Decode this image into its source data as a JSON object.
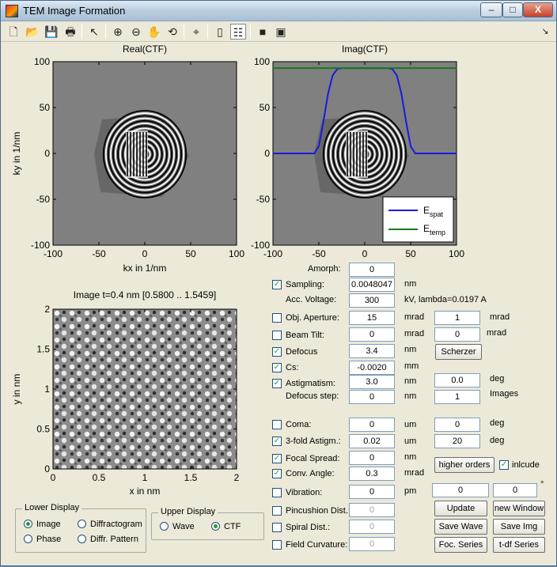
{
  "window": {
    "title": "TEM Image Formation",
    "controls": {
      "minimize": "–",
      "maximize": "□",
      "close": "X"
    }
  },
  "toolbar": {
    "icons": [
      "new-file-icon",
      "open-folder-icon",
      "save-icon",
      "print-icon",
      "pointer-icon",
      "zoom-in-icon",
      "zoom-out-icon",
      "pan-hand-icon",
      "rotate-icon",
      "data-cursor-icon",
      "colorbar-icon",
      "legend-icon",
      "hide-plot-tools-icon",
      "show-plot-tools-icon"
    ],
    "dock_arrow": "↘"
  },
  "plots": {
    "real_ctf": {
      "title": "Real(CTF)",
      "xlabel": "kx in 1/nm",
      "ylabel": "ky in 1/nm",
      "xticks": [
        "-100",
        "-50",
        "0",
        "50",
        "100"
      ],
      "yticks": [
        "100",
        "50",
        "0",
        "-50",
        "-100"
      ]
    },
    "imag_ctf": {
      "title": "Imag(CTF)",
      "xticks": [
        "-100",
        "-50",
        "0",
        "50",
        "100"
      ],
      "yticks": [
        "100",
        "50",
        "0",
        "-50",
        "-100"
      ],
      "legend": [
        {
          "name": "E",
          "sub": "spat",
          "color": "#1a1adf"
        },
        {
          "name": "E",
          "sub": "temp",
          "color": "#1a7a1a"
        }
      ]
    },
    "image": {
      "title": "Image t=0.4 nm [0.5800 .. 1.5459]",
      "xlabel": "x in nm",
      "ylabel": "y in nm",
      "xticks": [
        "0",
        "0.5",
        "1",
        "1.5",
        "2"
      ],
      "yticks": [
        "2",
        "1.5",
        "1",
        "0.5",
        "0"
      ]
    }
  },
  "chart_data": {
    "type": "line",
    "title": "Imag(CTF)",
    "xlim": [
      -100,
      100
    ],
    "ylim": [
      -100,
      100
    ],
    "series": [
      {
        "name": "E_spat",
        "color": "#1a1adf",
        "x": [
          -105,
          -55,
          -50,
          -45,
          -40,
          -35,
          -30,
          -25,
          -20,
          0,
          20,
          25,
          30,
          35,
          40,
          45,
          50,
          55,
          105
        ],
        "y": [
          0,
          0,
          8,
          35,
          65,
          85,
          92,
          93,
          93,
          93,
          93,
          93,
          92,
          85,
          65,
          35,
          8,
          0,
          0
        ]
      },
      {
        "name": "E_temp",
        "color": "#1a7a1a",
        "x": [
          -105,
          105
        ],
        "y": [
          93,
          93
        ]
      }
    ]
  },
  "params": {
    "amorph": {
      "label": "Amorph:",
      "value": "0"
    },
    "sampling": {
      "label": "Sampling:",
      "value": "0.0048047",
      "unit": "nm",
      "checked": true
    },
    "voltage": {
      "label": "Acc. Voltage:",
      "value": "300",
      "unit": "kV, lambda=0.0197 A"
    },
    "obj_aperture": {
      "label": "Obj. Aperture:",
      "value": "15",
      "unit": "mrad",
      "value2": "1",
      "unit2": "mrad",
      "checked": false
    },
    "beam_tilt": {
      "label": "Beam Tilt:",
      "value": "0",
      "unit": "mrad",
      "value2": "0",
      "unit2": "mrad",
      "checked": false
    },
    "defocus": {
      "label": "Defocus",
      "value": "3.4",
      "unit": "nm",
      "checked": true
    },
    "cs": {
      "label": "Cs:",
      "value": "-0.0020",
      "unit": "mm",
      "checked": true
    },
    "astig": {
      "label": "Astigmatism:",
      "value": "3.0",
      "unit": "nm",
      "value2": "0.0",
      "unit2": "deg",
      "checked": true
    },
    "defocus_step": {
      "label": "Defocus step:",
      "value": "0",
      "unit": "nm",
      "value2": "1",
      "unit2": "Images"
    },
    "coma": {
      "label": "Coma:",
      "value": "0",
      "unit": "um",
      "value2": "0",
      "unit2": "deg",
      "checked": false
    },
    "astig3": {
      "label": "3-fold Astigm.:",
      "value": "0.02",
      "unit": "um",
      "value2": "20",
      "unit2": "deg",
      "checked": true
    },
    "focal_spread": {
      "label": "Focal Spread:",
      "value": "0",
      "unit": "nm",
      "checked": true
    },
    "conv_angle": {
      "label": "Conv. Angle:",
      "value": "0.3",
      "unit": "mrad",
      "checked": true
    },
    "vibration": {
      "label": "Vibration:",
      "value": "0",
      "unit": "pm",
      "value2": "0",
      "unit2": "pm",
      "value3": "0",
      "unit3": "°",
      "checked": false
    },
    "pincushion": {
      "label": "Pincushion Dist.:",
      "value": "0",
      "checked": false
    },
    "spiral": {
      "label": "Spiral Dist.:",
      "value": "0",
      "checked": false
    },
    "field_curv": {
      "label": "Field Curvature:",
      "value": "0",
      "checked": false
    }
  },
  "buttons": {
    "scherzer": "Scherzer",
    "higher_orders": "higher orders",
    "include": "inlcude",
    "update": "Update",
    "new_window": "new Window",
    "save_wave": "Save Wave",
    "save_img": "Save Img",
    "foc_series": "Foc. Series",
    "tdf_series": "t-df Series"
  },
  "lower_display": {
    "title": "Lower Display",
    "options": [
      "Image",
      "Diffractogram",
      "Phase",
      "Diffr. Pattern"
    ],
    "selected": "Image"
  },
  "upper_display": {
    "title": "Upper Display",
    "options": [
      "Wave",
      "CTF"
    ],
    "selected": "CTF"
  }
}
